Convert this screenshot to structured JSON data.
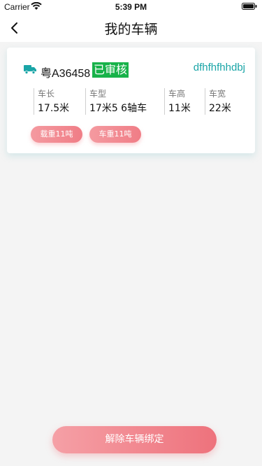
{
  "status_bar": {
    "carrier": "Carrier",
    "time": "5:39 PM"
  },
  "nav": {
    "title": "我的车辆"
  },
  "vehicle": {
    "plate": "粤A36458",
    "status": "已审核",
    "owner": "dfhfhfhhdbj",
    "specs": {
      "length": {
        "label": "车长",
        "value": "17.5米"
      },
      "type": {
        "label": "车型",
        "value": "17米5 6轴车"
      },
      "height": {
        "label": "车高",
        "value": "11米"
      },
      "width": {
        "label": "车宽",
        "value": "22米"
      }
    },
    "tags": [
      "载重11吨",
      "车重11吨"
    ]
  },
  "actions": {
    "unbind_label": "解除车辆绑定"
  },
  "colors": {
    "accent_teal": "#1aa5a7",
    "status_green": "#18b24a",
    "pink": "#f07d86",
    "background": "#f4f4f4"
  },
  "icons": {
    "back": "chevron-left-icon",
    "truck": "truck-icon",
    "wifi": "wifi-icon",
    "battery": "battery-icon"
  }
}
